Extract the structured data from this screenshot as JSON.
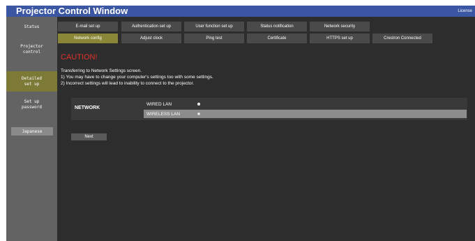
{
  "window": {
    "title": "Projector Control Window",
    "license_link": "License"
  },
  "sidebar": {
    "items": [
      {
        "label": "Status"
      },
      {
        "label": "Projector\ncontrol"
      },
      {
        "label": "Detailed\nset up"
      },
      {
        "label": "Set up\npassword"
      }
    ],
    "language_button": "Japanese"
  },
  "tabs": {
    "row1": [
      "E-mail set up",
      "Authentication set up",
      "User function set up",
      "Status notification",
      "Network security"
    ],
    "row2": [
      "Network config",
      "Adjust clock",
      "Ping test",
      "Certificate",
      "HTTPS set up",
      "Crestron Connected"
    ]
  },
  "content": {
    "caution_title": "CAUTION!",
    "lines": [
      "Transferring to Network Settings screen.",
      "1) You may have to change your computer's settings too with some settings.",
      "2) Incorrect settings will lead to inability to connect to the projector."
    ],
    "network_label": "NETWORK",
    "options": [
      "WIRED LAN",
      "WIRELESS LAN"
    ],
    "next_button": "Next"
  },
  "colors": {
    "title_bar": "#3b57a3",
    "active_item": "#8b8739",
    "caution": "#e0322a"
  }
}
